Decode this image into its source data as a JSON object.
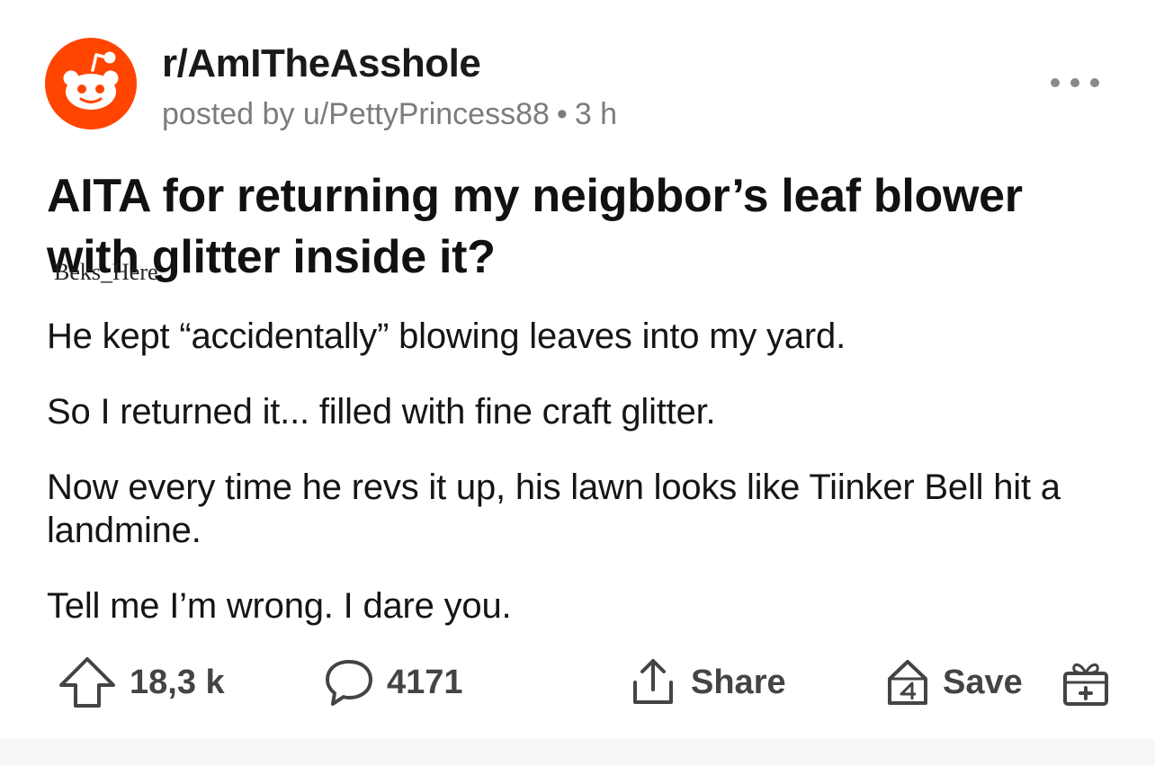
{
  "post": {
    "subreddit": "r/AmITheAsshole",
    "posted_by": "posted by u/PettyPrincess88",
    "separator": "•",
    "time": "3 h",
    "title": "AITA for returning my neigbbor’s leaf blower with glitter inside it?",
    "watermark": "Beks_Here",
    "paragraphs": [
      "He kept “accidentally” blowing leaves into my yard.",
      "So I returned it... filled with fine craft glitter.",
      "Now every time he revs it up, his lawn looks like Tiinker Bell hit a landmine.",
      "Tell me I’m wrong. I dare you."
    ]
  },
  "actions": {
    "upvotes": "18,3 k",
    "comments": "4171",
    "share": "Share",
    "save": "Save"
  },
  "icons": {
    "avatar": "reddit-snoo-icon",
    "more": "more-options-icon",
    "upvote": "upvote-arrow-icon",
    "comment": "comment-bubble-icon",
    "share": "share-upload-icon",
    "save": "save-bookmark-icon",
    "gift": "gift-award-icon"
  },
  "colors": {
    "brand": "#ff4500",
    "meta": "#7c7c7c",
    "action": "#444444"
  }
}
